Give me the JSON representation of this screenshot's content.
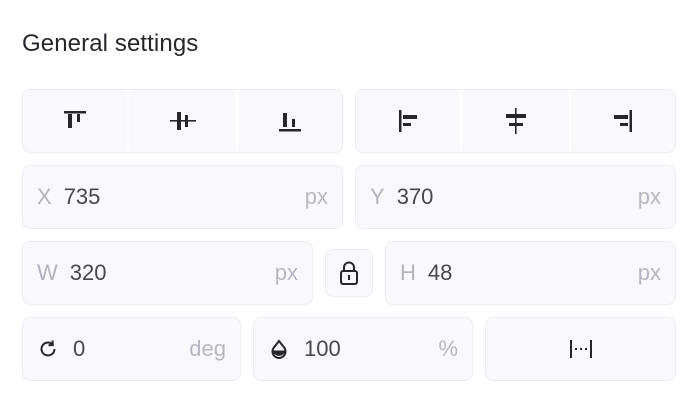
{
  "panel": {
    "title": "General settings"
  },
  "align_vertical": [
    {
      "icon": "align-top-icon"
    },
    {
      "icon": "align-vertical-center-icon"
    },
    {
      "icon": "align-bottom-icon"
    }
  ],
  "align_horizontal": [
    {
      "icon": "align-left-icon"
    },
    {
      "icon": "align-horizontal-center-icon"
    },
    {
      "icon": "align-right-icon"
    }
  ],
  "position": {
    "x": {
      "label": "X",
      "value": "735",
      "unit": "px"
    },
    "y": {
      "label": "Y",
      "value": "370",
      "unit": "px"
    }
  },
  "size": {
    "w": {
      "label": "W",
      "value": "320",
      "unit": "px"
    },
    "h": {
      "label": "H",
      "value": "48",
      "unit": "px"
    },
    "lock_icon": "lock-icon"
  },
  "rotation": {
    "value": "0",
    "unit": "deg",
    "icon": "rotate-icon"
  },
  "opacity": {
    "value": "100",
    "unit": "%",
    "icon": "opacity-drop-icon"
  },
  "spacing": {
    "icon": "distribute-spacing-icon"
  },
  "colors": {
    "icon": "#27262b",
    "box_bg": "#f9f8fc",
    "muted": "#b4b2bd"
  }
}
